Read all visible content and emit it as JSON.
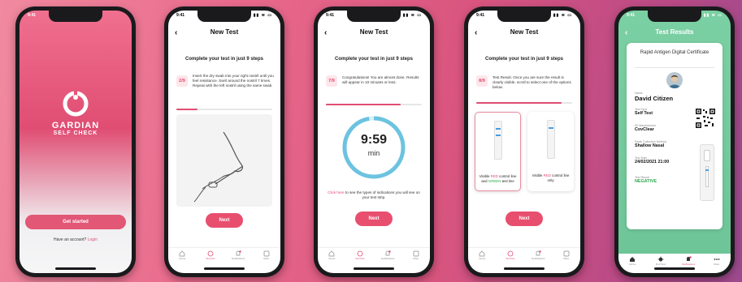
{
  "status_time": "9:41",
  "status_icons": "▮▮ ≋ ▭",
  "splash": {
    "brand_line1": "GARDIAN",
    "brand_line2": "SELF CHECK",
    "get_started": "Get started",
    "account_prompt": "Have an account?",
    "login": "Login"
  },
  "new_test_title": "New Test",
  "steps_heading": "Complete your test in just 9 steps",
  "screen2": {
    "step_num": "2",
    "step_total": "9",
    "text": "Insert the dry swab into your right nostril until you feel resistance. Swirl around the nostril 7 times. Repeat with the left nostril using the same swab.",
    "progress": 0.22,
    "next": "Next"
  },
  "screen3": {
    "step_num": "7",
    "step_total": "9",
    "text": "Congratulations! You are almost done. Results will appear in 10 minutes or less.",
    "progress": 0.78,
    "timer": "9:59",
    "timer_unit": "min",
    "hint_link": "Click here",
    "hint_rest": " to see the types of indications you will see on your test strip.",
    "next": "Next"
  },
  "screen4": {
    "step_num": "8",
    "step_total": "9",
    "text": "Test Result. Once you are sure the result is clearly visible, scroll to select one of the options below.",
    "progress": 0.89,
    "option1": {
      "a": "Visible ",
      "red": "RED",
      "b": " control line and ",
      "green": "GREEN",
      "c": " test line"
    },
    "option2": {
      "a": "Visible ",
      "red": "RED",
      "b": " control line only"
    },
    "next": "Next"
  },
  "tabs": [
    "Home",
    "Test Kits",
    "Notifications",
    "More"
  ],
  "results": {
    "title": "Test Results",
    "cert_title": "Rapid Antigen Digital Certificate",
    "name_label": "Name",
    "name": "David Citizen",
    "type_label": "Test Type",
    "type": "Self Test",
    "kit_label": "Kit Manufacturer",
    "kit": "CovClear",
    "method_label": "Swab Collection Method",
    "method": "Shallow Nasal",
    "date_label": "Test Date",
    "date": "24/02/2021 21:00",
    "result_label": "Test Result",
    "result": "NEGATIVE",
    "tabs": [
      "Home",
      "Find Test",
      "Notifications",
      "More"
    ]
  },
  "colors": {
    "accent": "#e04d73",
    "success": "#2fa84f",
    "results_bg": "#7bd0a3"
  }
}
